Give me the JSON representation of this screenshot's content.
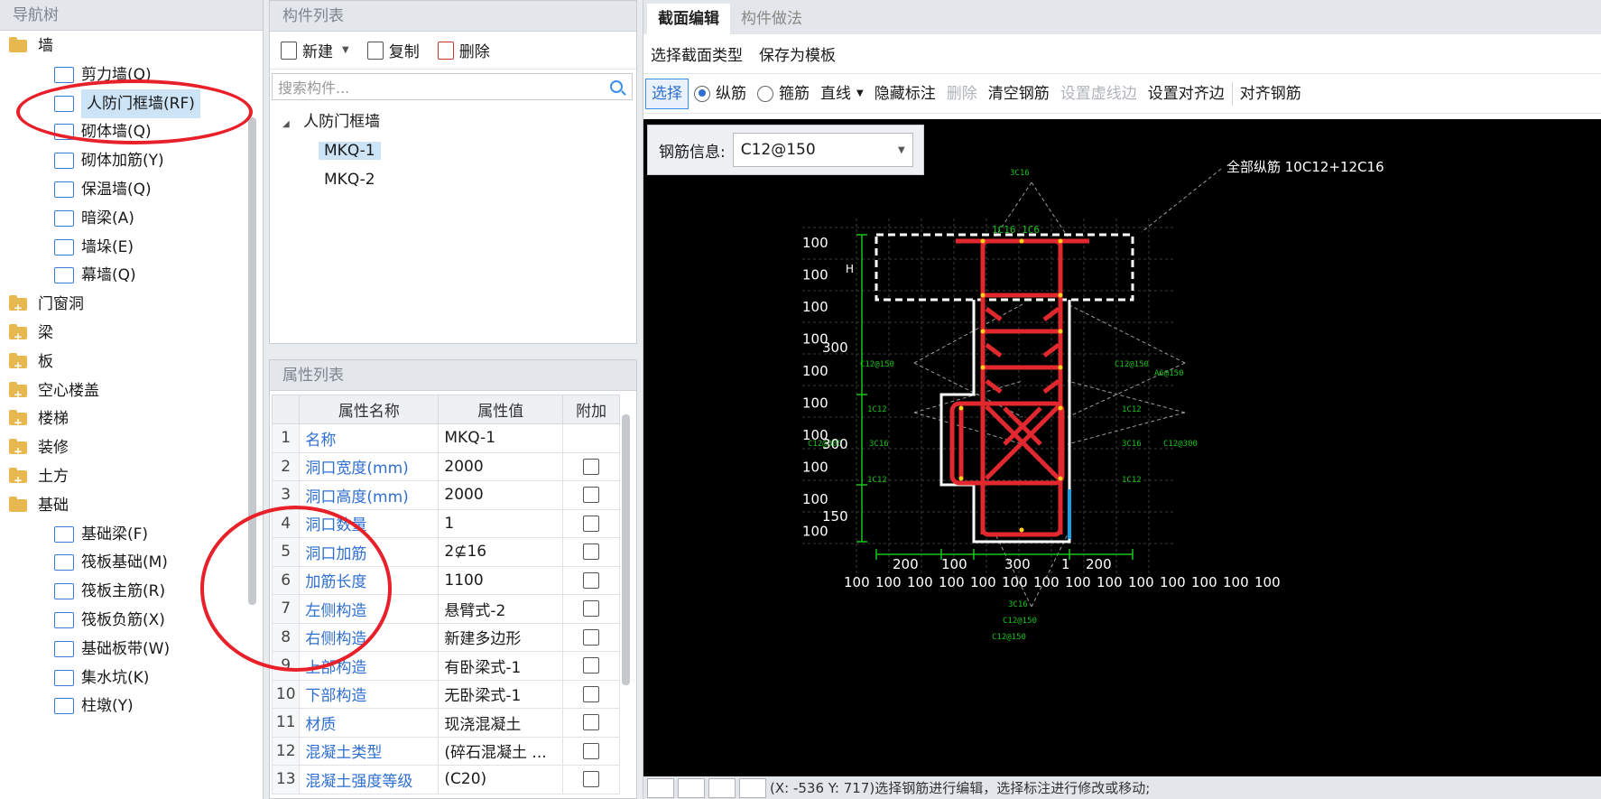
{
  "nav": {
    "header": "导航树",
    "items": [
      {
        "label": "墙",
        "type": "folder",
        "open": true,
        "icon": "folder-open-icon"
      },
      {
        "label": "剪力墙(Q)",
        "type": "child",
        "icon": "shear-wall-icon"
      },
      {
        "label": "人防门框墙(RF)",
        "type": "child",
        "icon": "blast-door-frame-wall-icon",
        "selected": true
      },
      {
        "label": "砌体墙(Q)",
        "type": "child",
        "icon": "masonry-wall-icon"
      },
      {
        "label": "砌体加筋(Y)",
        "type": "child",
        "icon": "masonry-reinforcement-icon"
      },
      {
        "label": "保温墙(Q)",
        "type": "child",
        "icon": "insulation-wall-icon"
      },
      {
        "label": "暗梁(A)",
        "type": "child",
        "icon": "hidden-beam-icon"
      },
      {
        "label": "墙垛(E)",
        "type": "child",
        "icon": "wall-pier-icon"
      },
      {
        "label": "幕墙(Q)",
        "type": "child",
        "icon": "curtain-wall-icon"
      },
      {
        "label": "门窗洞",
        "type": "folder",
        "icon": "folder-closed-icon"
      },
      {
        "label": "梁",
        "type": "folder",
        "icon": "folder-closed-icon"
      },
      {
        "label": "板",
        "type": "folder",
        "icon": "folder-closed-icon"
      },
      {
        "label": "空心楼盖",
        "type": "folder",
        "icon": "folder-closed-icon"
      },
      {
        "label": "楼梯",
        "type": "folder",
        "icon": "folder-closed-icon"
      },
      {
        "label": "装修",
        "type": "folder",
        "icon": "folder-closed-icon"
      },
      {
        "label": "土方",
        "type": "folder",
        "icon": "folder-closed-icon"
      },
      {
        "label": "基础",
        "type": "folder",
        "open": true,
        "icon": "folder-open-icon"
      },
      {
        "label": "基础梁(F)",
        "type": "child",
        "icon": "foundation-beam-icon"
      },
      {
        "label": "筏板基础(M)",
        "type": "child",
        "icon": "raft-foundation-icon"
      },
      {
        "label": "筏板主筋(R)",
        "type": "child",
        "icon": "raft-main-rebar-icon"
      },
      {
        "label": "筏板负筋(X)",
        "type": "child",
        "icon": "raft-negative-rebar-icon"
      },
      {
        "label": "基础板带(W)",
        "type": "child",
        "icon": "foundation-strip-icon"
      },
      {
        "label": "集水坑(K)",
        "type": "child",
        "icon": "sump-pit-icon"
      },
      {
        "label": "柱墩(Y)",
        "type": "child",
        "icon": "column-pier-icon"
      }
    ]
  },
  "component_list": {
    "header": "构件列表",
    "toolbar": {
      "new_label": "新建",
      "copy_label": "复制",
      "delete_label": "删除"
    },
    "search_placeholder": "搜索构件...",
    "tree": {
      "group": "人防门框墙",
      "items": [
        {
          "label": "MKQ-1",
          "selected": true
        },
        {
          "label": "MKQ-2",
          "selected": false
        }
      ]
    }
  },
  "properties": {
    "header": "属性列表",
    "columns": [
      "属性名称",
      "属性值",
      "附加"
    ],
    "rows": [
      {
        "n": "1",
        "name": "名称",
        "value": "MKQ-1",
        "has_check": false
      },
      {
        "n": "2",
        "name": "洞口宽度(mm)",
        "value": "2000",
        "has_check": true
      },
      {
        "n": "3",
        "name": "洞口高度(mm)",
        "value": "2000",
        "has_check": true
      },
      {
        "n": "4",
        "name": "洞口数量",
        "value": "1",
        "has_check": true
      },
      {
        "n": "5",
        "name": "洞口加筋",
        "value": "2⊈16",
        "has_check": true
      },
      {
        "n": "6",
        "name": "加筋长度",
        "value": "1100",
        "has_check": true
      },
      {
        "n": "7",
        "name": "左侧构造",
        "value": "悬臂式-2",
        "has_check": true
      },
      {
        "n": "8",
        "name": "右侧构造",
        "value": "新建多边形",
        "has_check": true
      },
      {
        "n": "9",
        "name": "上部构造",
        "value": "有卧梁式-1",
        "has_check": true
      },
      {
        "n": "10",
        "name": "下部构造",
        "value": "无卧梁式-1",
        "has_check": true
      },
      {
        "n": "11",
        "name": "材质",
        "value": "现浇混凝土",
        "has_check": true
      },
      {
        "n": "12",
        "name": "混凝土类型",
        "value": "(碎石混凝土 ...",
        "has_check": true
      },
      {
        "n": "13",
        "name": "混凝土强度等级",
        "value": "(C20)",
        "has_check": true
      }
    ]
  },
  "editor": {
    "tabs": [
      {
        "label": "截面编辑",
        "active": true
      },
      {
        "label": "构件做法",
        "active": false
      }
    ],
    "subbar": {
      "select_type": "选择截面类型",
      "save_template": "保存为模板"
    },
    "rebar_toolbar": {
      "select": "选择",
      "longitudinal": "纵筋",
      "stirrup": "箍筋",
      "line": "直线",
      "hide_annotation": "隐藏标注",
      "delete": "删除",
      "clear_rebar": "清空钢筋",
      "set_virtual_edge": "设置虚线边",
      "set_align_edge": "设置对齐边",
      "align_rebar": "对齐钢筋"
    },
    "rebar_info": {
      "label": "钢筋信息:",
      "value": "C12@150"
    },
    "drawing": {
      "total_rebar": "全部纵筋 10C12+12C16",
      "top_rebar": "3C16",
      "top_stirrup": "1C16 1C6",
      "h_label": "H",
      "left_dims": [
        "100",
        "100",
        "100",
        "100",
        "100",
        "100",
        "100",
        "100",
        "100",
        "100"
      ],
      "left_big_dims": [
        "300",
        "300",
        "150"
      ],
      "left_notes": [
        "C12@150",
        "1C12",
        "C12@300",
        "3C16",
        "1C12"
      ],
      "right_notes": [
        "C12@150",
        "A6@150",
        "1C12",
        "3C16",
        "C12@300",
        "1C12"
      ],
      "bottom_dims_top": [
        "200",
        "100",
        "300",
        "1",
        "200"
      ],
      "bottom_dims_bottom": [
        "100",
        "100",
        "100",
        "100",
        "100",
        "100",
        "100",
        "100",
        "100",
        "100",
        "100",
        "100",
        "100",
        "100"
      ],
      "bottom_notes": [
        "3C16",
        "C12@150",
        "C12@150"
      ]
    },
    "status": "(X: -536 Y: 717)选择钢筋进行编辑，选择标注进行修改或移动;"
  },
  "colors": {
    "accent": "#2f6fd0",
    "rebar": "#e0282e",
    "annotation": "#19c219",
    "highlight_ring": "#e8202a",
    "canvas_bg": "#000000"
  }
}
